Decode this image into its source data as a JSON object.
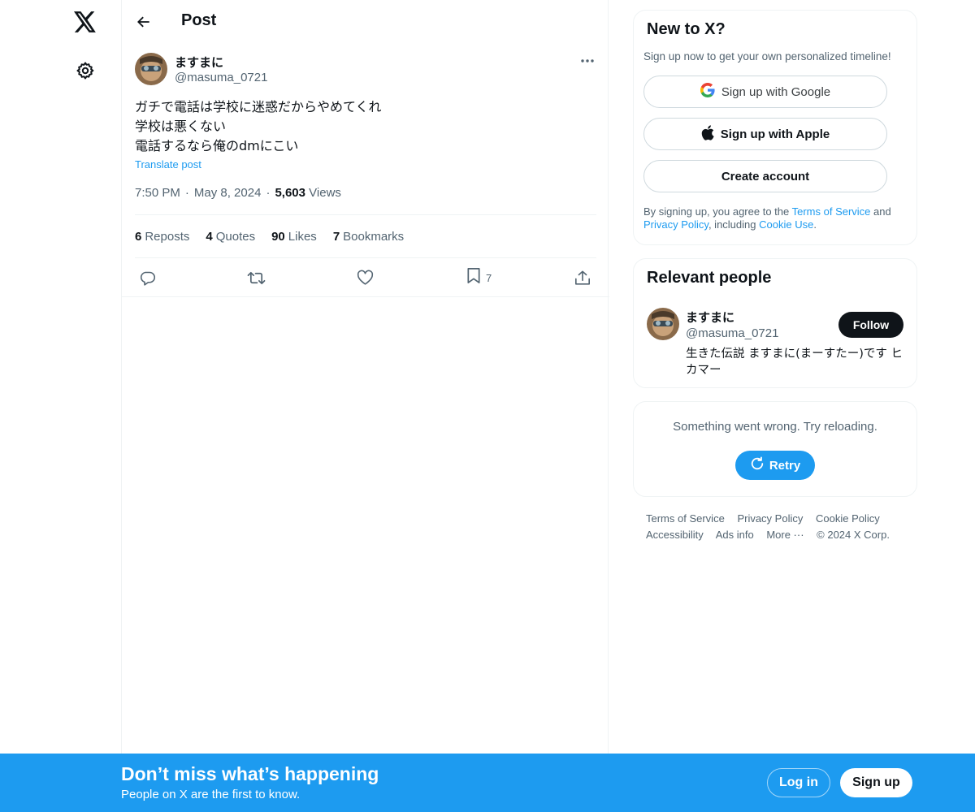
{
  "nav": {
    "logo_icon": "x-logo-icon",
    "settings_icon": "gear-icon"
  },
  "header": {
    "back_icon": "arrow-left-icon",
    "title": "Post"
  },
  "post": {
    "author_name": "ますまに",
    "author_handle": "@masuma_0721",
    "text_lines": [
      "ガチで電話は学校に迷惑だからやめてくれ",
      "学校は悪くない",
      "電話するなら俺のdmにこい"
    ],
    "translate_label": "Translate post",
    "time": "7:50 PM",
    "date": "May 8, 2024",
    "views_count": "5,603",
    "views_label": "Views",
    "separator": "·",
    "stats": {
      "reposts_count": "6",
      "reposts_label": "Reposts",
      "quotes_count": "4",
      "quotes_label": "Quotes",
      "likes_count": "90",
      "likes_label": "Likes",
      "bookmarks_count": "7",
      "bookmarks_label": "Bookmarks"
    },
    "actions": {
      "reply_icon": "reply-icon",
      "repost_icon": "repost-icon",
      "like_icon": "heart-icon",
      "bookmark_icon": "bookmark-icon",
      "bookmark_count": "7",
      "share_icon": "share-icon"
    }
  },
  "signup_card": {
    "title": "New to X?",
    "subtitle": "Sign up now to get your own personalized timeline!",
    "google_label": "Sign up with Google",
    "apple_label": "Sign up with Apple",
    "create_label": "Create account",
    "legal_prefix": "By signing up, you agree to the ",
    "terms_link": "Terms of Service",
    "legal_and": " and ",
    "privacy_link": "Privacy Policy",
    "legal_including": ", including ",
    "cookie_link": "Cookie Use",
    "legal_end": "."
  },
  "relevant_people": {
    "title": "Relevant people",
    "name": "ますまに",
    "handle": "@masuma_0721",
    "follow_label": "Follow",
    "bio": "生きた伝説 ますまに(まーすたー)です ヒカマー"
  },
  "error_card": {
    "message": "Something went wrong. Try reloading.",
    "retry_label": "Retry"
  },
  "footer": {
    "terms": "Terms of Service",
    "privacy": "Privacy Policy",
    "cookie": "Cookie Policy",
    "accessibility": "Accessibility",
    "ads": "Ads info",
    "more": "More ···",
    "copyright": "© 2024 X Corp."
  },
  "banner": {
    "title": "Don’t miss what’s happening",
    "subtitle": "People on X are the first to know.",
    "login_label": "Log in",
    "signup_label": "Sign up"
  },
  "colors": {
    "accent": "#1d9bf0",
    "text": "#0f1419",
    "muted": "#536471"
  }
}
